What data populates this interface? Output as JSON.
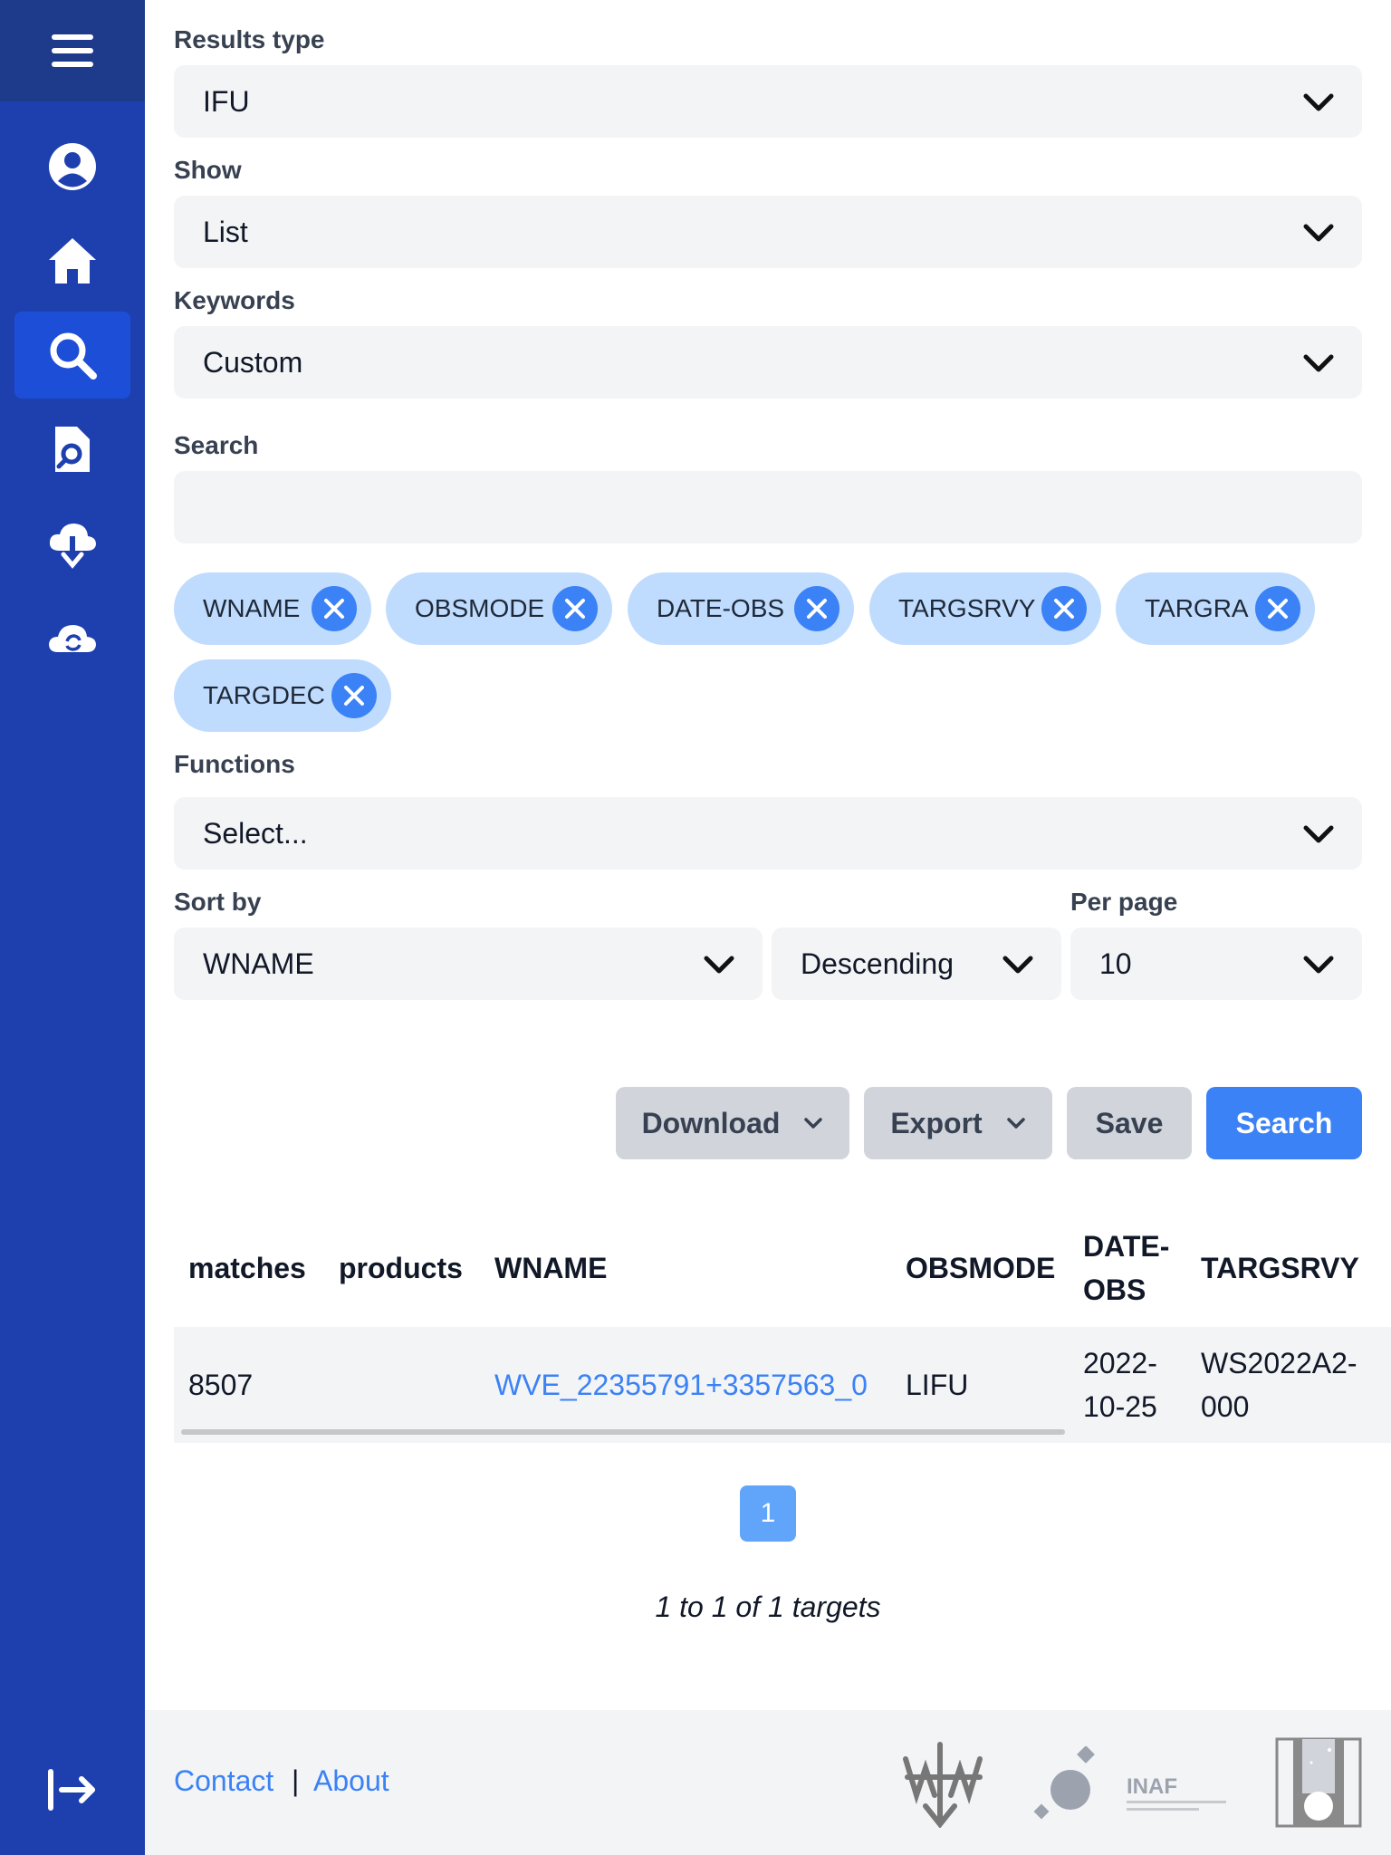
{
  "form": {
    "results_type": {
      "label": "Results type",
      "value": "IFU"
    },
    "show": {
      "label": "Show",
      "value": "List"
    },
    "keywords": {
      "label": "Keywords",
      "value": "Custom"
    },
    "search": {
      "label": "Search",
      "value": ""
    },
    "chips": [
      "WNAME",
      "OBSMODE",
      "DATE-OBS",
      "TARGSRVY",
      "TARGRA",
      "TARGDEC"
    ],
    "functions": {
      "label": "Functions",
      "placeholder": "Select..."
    },
    "sort_by": {
      "label": "Sort by",
      "value": "WNAME",
      "order": "Descending"
    },
    "per_page": {
      "label": "Per page",
      "value": "10"
    }
  },
  "buttons": {
    "download": "Download",
    "export": "Export",
    "save": "Save",
    "search": "Search"
  },
  "table": {
    "headers": [
      "matches",
      "products",
      "WNAME",
      "OBSMODE",
      "DATE-",
      "OBS",
      "TARGSRVY"
    ],
    "row": {
      "matches": "8507",
      "products": "",
      "wname": "WVE_22355791+3357563_0",
      "obsmode": "LIFU",
      "date_line1": "2022-",
      "date_line2": "10-25",
      "targsrvy_line1": "WS2022A2-",
      "targsrvy_line2": "000"
    }
  },
  "pagination": {
    "current": "1",
    "summary": "1 to 1 of 1 targets"
  },
  "footer": {
    "contact": "Contact",
    "separator": "|",
    "about": "About",
    "inaf": "INAF"
  },
  "colors": {
    "sidebar": "#1e40af",
    "accent": "#3b82f6",
    "chip": "#bfdbfe"
  },
  "icons": [
    "menu-icon",
    "user-icon",
    "home-icon",
    "search-icon",
    "file-search-icon",
    "cloud-download-icon",
    "cloud-sync-icon",
    "logout-icon",
    "chevron-down-icon",
    "close-icon"
  ]
}
